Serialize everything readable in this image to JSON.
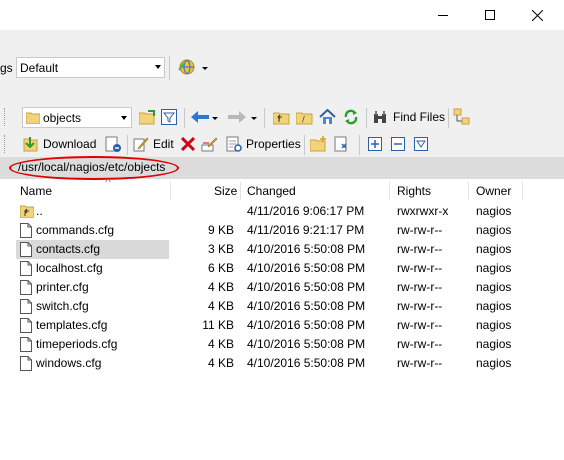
{
  "window": {
    "minimize_icon": "minimize-icon",
    "maximize_icon": "maximize-icon",
    "close_icon": "close-icon"
  },
  "session": {
    "label_fragment": "gs",
    "profile_value": "Default",
    "globe_icon": "network-globe-icon"
  },
  "toolbar1": {
    "directory_value": "objects",
    "find_files_label": "Find Files"
  },
  "toolbar2": {
    "download_label": "Download",
    "edit_label": "Edit",
    "properties_label": "Properties"
  },
  "path": {
    "current_path": "/usr/local/nagios/etc/objects",
    "highlight_color": "#e00000"
  },
  "list": {
    "columns": [
      "Name",
      "Size",
      "Changed",
      "Rights",
      "Owner"
    ],
    "rows": [
      {
        "name": "..",
        "size": "",
        "changed": "4/11/2016 9:06:17 PM",
        "rights": "rwxrwxr-x",
        "owner": "nagios",
        "type": "parent"
      },
      {
        "name": "commands.cfg",
        "size": "9 KB",
        "changed": "4/11/2016 9:21:17 PM",
        "rights": "rw-rw-r--",
        "owner": "nagios",
        "type": "file"
      },
      {
        "name": "contacts.cfg",
        "size": "3 KB",
        "changed": "4/10/2016 5:50:08 PM",
        "rights": "rw-rw-r--",
        "owner": "nagios",
        "type": "file",
        "selected": true
      },
      {
        "name": "localhost.cfg",
        "size": "6 KB",
        "changed": "4/10/2016 5:50:08 PM",
        "rights": "rw-rw-r--",
        "owner": "nagios",
        "type": "file"
      },
      {
        "name": "printer.cfg",
        "size": "4 KB",
        "changed": "4/10/2016 5:50:08 PM",
        "rights": "rw-rw-r--",
        "owner": "nagios",
        "type": "file"
      },
      {
        "name": "switch.cfg",
        "size": "4 KB",
        "changed": "4/10/2016 5:50:08 PM",
        "rights": "rw-rw-r--",
        "owner": "nagios",
        "type": "file"
      },
      {
        "name": "templates.cfg",
        "size": "11 KB",
        "changed": "4/10/2016 5:50:08 PM",
        "rights": "rw-rw-r--",
        "owner": "nagios",
        "type": "file"
      },
      {
        "name": "timeperiods.cfg",
        "size": "4 KB",
        "changed": "4/10/2016 5:50:08 PM",
        "rights": "rw-rw-r--",
        "owner": "nagios",
        "type": "file"
      },
      {
        "name": "windows.cfg",
        "size": "4 KB",
        "changed": "4/10/2016 5:50:08 PM",
        "rights": "rw-rw-r--",
        "owner": "nagios",
        "type": "file"
      }
    ]
  }
}
